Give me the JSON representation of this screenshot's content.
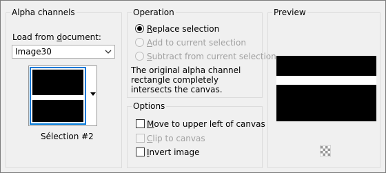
{
  "alpha_channels": {
    "title": "Alpha channels",
    "load_label_prefix": "Load from ",
    "load_label_underlined": "d",
    "load_label_suffix": "ocument:",
    "document_value": "Image30",
    "selection_name": "Sélection #2"
  },
  "operation": {
    "title": "Operation",
    "options": [
      {
        "u": "R",
        "rest": "eplace selection",
        "checked": true,
        "disabled": false
      },
      {
        "u": "A",
        "rest": "dd to current selection",
        "checked": false,
        "disabled": true
      },
      {
        "u": "S",
        "rest": "ubtract from current selection",
        "checked": false,
        "disabled": true
      }
    ],
    "description": "The original alpha channel rectangle completely intersects the canvas."
  },
  "options_group": {
    "title": "Options",
    "items": [
      {
        "u": "M",
        "rest": "ove to upper left of canvas",
        "checked": false,
        "disabled": false
      },
      {
        "u": "C",
        "rest": "lip to canvas",
        "checked": false,
        "disabled": true
      },
      {
        "u": "I",
        "rest": "nvert image",
        "checked": false,
        "disabled": false
      }
    ]
  },
  "preview": {
    "title": "Preview"
  },
  "colors": {
    "selection_border": "#0078d7",
    "image_fill": "#000000",
    "band_fill": "#ffffff"
  }
}
